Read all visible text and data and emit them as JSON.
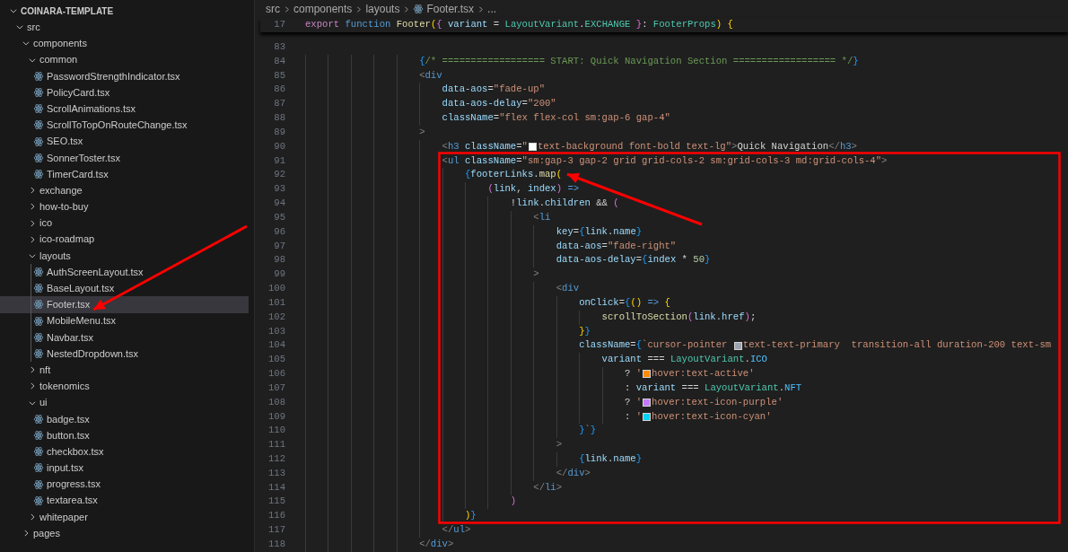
{
  "explorer": {
    "tree": [
      {
        "label": "COINARA-TEMPLATE",
        "kind": "root",
        "expanded": true,
        "selected": false,
        "children": [
          {
            "label": "src",
            "kind": "folder",
            "expanded": true,
            "selected": false,
            "children": [
              {
                "label": "components",
                "kind": "folder",
                "expanded": true,
                "selected": false,
                "children": [
                  {
                    "label": "common",
                    "kind": "folder",
                    "expanded": true,
                    "selected": false,
                    "children": [
                      {
                        "label": "PasswordStrengthIndicator.tsx",
                        "kind": "file",
                        "selected": false
                      },
                      {
                        "label": "PolicyCard.tsx",
                        "kind": "file",
                        "selected": false
                      },
                      {
                        "label": "ScrollAnimations.tsx",
                        "kind": "file",
                        "selected": false
                      },
                      {
                        "label": "ScrollToTopOnRouteChange.tsx",
                        "kind": "file",
                        "selected": false
                      },
                      {
                        "label": "SEO.tsx",
                        "kind": "file",
                        "selected": false
                      },
                      {
                        "label": "SonnerToster.tsx",
                        "kind": "file",
                        "selected": false
                      },
                      {
                        "label": "TimerCard.tsx",
                        "kind": "file",
                        "selected": false
                      }
                    ]
                  },
                  {
                    "label": "exchange",
                    "kind": "folder",
                    "expanded": false,
                    "selected": false
                  },
                  {
                    "label": "how-to-buy",
                    "kind": "folder",
                    "expanded": false,
                    "selected": false
                  },
                  {
                    "label": "ico",
                    "kind": "folder",
                    "expanded": false,
                    "selected": false
                  },
                  {
                    "label": "ico-roadmap",
                    "kind": "folder",
                    "expanded": false,
                    "selected": false
                  },
                  {
                    "label": "layouts",
                    "kind": "folder",
                    "expanded": true,
                    "selected": false,
                    "children": [
                      {
                        "label": "AuthScreenLayout.tsx",
                        "kind": "file",
                        "selected": false
                      },
                      {
                        "label": "BaseLayout.tsx",
                        "kind": "file",
                        "selected": false
                      },
                      {
                        "label": "Footer.tsx",
                        "kind": "file",
                        "selected": true
                      },
                      {
                        "label": "MobileMenu.tsx",
                        "kind": "file",
                        "selected": false
                      },
                      {
                        "label": "Navbar.tsx",
                        "kind": "file",
                        "selected": false
                      },
                      {
                        "label": "NestedDropdown.tsx",
                        "kind": "file",
                        "selected": false
                      }
                    ]
                  },
                  {
                    "label": "nft",
                    "kind": "folder",
                    "expanded": false,
                    "selected": false
                  },
                  {
                    "label": "tokenomics",
                    "kind": "folder",
                    "expanded": false,
                    "selected": false
                  },
                  {
                    "label": "ui",
                    "kind": "folder",
                    "expanded": true,
                    "selected": false,
                    "children": [
                      {
                        "label": "badge.tsx",
                        "kind": "file",
                        "selected": false
                      },
                      {
                        "label": "button.tsx",
                        "kind": "file",
                        "selected": false
                      },
                      {
                        "label": "checkbox.tsx",
                        "kind": "file",
                        "selected": false
                      },
                      {
                        "label": "input.tsx",
                        "kind": "file",
                        "selected": false
                      },
                      {
                        "label": "progress.tsx",
                        "kind": "file",
                        "selected": false
                      },
                      {
                        "label": "textarea.tsx",
                        "kind": "file",
                        "selected": false
                      }
                    ]
                  },
                  {
                    "label": "whitepaper",
                    "kind": "folder",
                    "expanded": false,
                    "selected": false
                  }
                ]
              },
              {
                "label": "pages",
                "kind": "folder",
                "expanded": false,
                "selected": false
              }
            ]
          }
        ]
      }
    ]
  },
  "breadcrumbs": [
    {
      "label": "src",
      "kind": "folder"
    },
    {
      "label": "components",
      "kind": "folder"
    },
    {
      "label": "layouts",
      "kind": "folder"
    },
    {
      "label": "Footer.tsx",
      "kind": "file"
    },
    {
      "label": "...",
      "kind": "more"
    }
  ],
  "sticky_line": {
    "number": "17",
    "tokens": [
      {
        "kind": "control",
        "text": "export"
      },
      {
        "kind": "keyword",
        "text": " function"
      },
      {
        "kind": "function",
        "text": " Footer"
      },
      {
        "kind": "brace1",
        "text": "("
      },
      {
        "kind": "brace2",
        "text": "{"
      },
      {
        "kind": "variable",
        "text": " variant"
      },
      {
        "kind": "plain",
        "text": " = "
      },
      {
        "kind": "type",
        "text": "LayoutVariant"
      },
      {
        "kind": "plain",
        "text": "."
      },
      {
        "kind": "type",
        "text": "EXCHANGE"
      },
      {
        "kind": "brace2",
        "text": " }"
      },
      {
        "kind": "plain",
        "text": ": "
      },
      {
        "kind": "type",
        "text": "FooterProps"
      },
      {
        "kind": "brace1",
        "text": ")"
      },
      {
        "kind": "brace1",
        "text": " {"
      }
    ]
  },
  "lines": [
    {
      "number": "83"
    },
    {
      "number": "84",
      "tokens": [
        {
          "kind": "brace3",
          "text": "                    {"
        },
        {
          "kind": "comment",
          "text": "/* ================== START: Quick Navigation Section ================== */"
        },
        {
          "kind": "brace3",
          "text": "}"
        }
      ]
    },
    {
      "number": "85",
      "tokens": [
        {
          "kind": "angle",
          "text": "                    <"
        },
        {
          "kind": "keyword",
          "text": "div"
        }
      ]
    },
    {
      "number": "86",
      "tokens": [
        {
          "kind": "variable",
          "text": "                        data-aos"
        },
        {
          "kind": "plain",
          "text": "="
        },
        {
          "kind": "string",
          "text": "\"fade-up\""
        }
      ]
    },
    {
      "number": "87",
      "tokens": [
        {
          "kind": "variable",
          "text": "                        data-aos-delay"
        },
        {
          "kind": "plain",
          "text": "="
        },
        {
          "kind": "string",
          "text": "\"200\""
        }
      ]
    },
    {
      "number": "88",
      "tokens": [
        {
          "kind": "variable",
          "text": "                        className"
        },
        {
          "kind": "plain",
          "text": "="
        },
        {
          "kind": "string",
          "text": "\"flex flex-col sm:gap-6 gap-4\""
        }
      ]
    },
    {
      "number": "89",
      "tokens": [
        {
          "kind": "angle",
          "text": "                    >"
        }
      ]
    },
    {
      "number": "90",
      "tokens": [
        {
          "kind": "angle",
          "text": "                        <"
        },
        {
          "kind": "keyword",
          "text": "h3"
        },
        {
          "kind": "variable",
          "text": " className"
        },
        {
          "kind": "plain",
          "text": "="
        },
        {
          "kind": "string",
          "text": "\""
        },
        {
          "kind": "swatch",
          "color": "#ffffff"
        },
        {
          "kind": "string",
          "text": "text-background font-bold text-lg\""
        },
        {
          "kind": "angle",
          "text": ">"
        },
        {
          "kind": "plain",
          "text": "Quick Navigation"
        },
        {
          "kind": "angle",
          "text": "</"
        },
        {
          "kind": "keyword",
          "text": "h3"
        },
        {
          "kind": "angle",
          "text": ">"
        }
      ]
    },
    {
      "number": "91",
      "tokens": [
        {
          "kind": "angle",
          "text": "                        <"
        },
        {
          "kind": "keyword",
          "text": "ul"
        },
        {
          "kind": "variable",
          "text": " className"
        },
        {
          "kind": "plain",
          "text": "="
        },
        {
          "kind": "string",
          "text": "\"sm:gap-3 gap-2 grid grid-cols-2 sm:grid-cols-3 md:grid-cols-4\""
        },
        {
          "kind": "angle",
          "text": ">"
        }
      ]
    },
    {
      "number": "92",
      "tokens": [
        {
          "kind": "brace3",
          "text": "                            {"
        },
        {
          "kind": "variable",
          "text": "footerLinks"
        },
        {
          "kind": "plain",
          "text": "."
        },
        {
          "kind": "function",
          "text": "map"
        },
        {
          "kind": "brace1",
          "text": "("
        }
      ]
    },
    {
      "number": "93",
      "tokens": [
        {
          "kind": "brace2",
          "text": "                                ("
        },
        {
          "kind": "variable",
          "text": "link"
        },
        {
          "kind": "plain",
          "text": ", "
        },
        {
          "kind": "variable",
          "text": "index"
        },
        {
          "kind": "brace2",
          "text": ")"
        },
        {
          "kind": "keyword",
          "text": " =>"
        }
      ]
    },
    {
      "number": "94",
      "tokens": [
        {
          "kind": "plain",
          "text": "                                    !"
        },
        {
          "kind": "variable",
          "text": "link"
        },
        {
          "kind": "plain",
          "text": "."
        },
        {
          "kind": "variable",
          "text": "children"
        },
        {
          "kind": "plain",
          "text": " && "
        },
        {
          "kind": "brace2",
          "text": "("
        }
      ]
    },
    {
      "number": "95",
      "tokens": [
        {
          "kind": "angle",
          "text": "                                        <"
        },
        {
          "kind": "keyword",
          "text": "li"
        }
      ]
    },
    {
      "number": "96",
      "tokens": [
        {
          "kind": "variable",
          "text": "                                            key"
        },
        {
          "kind": "plain",
          "text": "="
        },
        {
          "kind": "brace3",
          "text": "{"
        },
        {
          "kind": "variable",
          "text": "link"
        },
        {
          "kind": "plain",
          "text": "."
        },
        {
          "kind": "variable",
          "text": "name"
        },
        {
          "kind": "brace3",
          "text": "}"
        }
      ]
    },
    {
      "number": "97",
      "tokens": [
        {
          "kind": "variable",
          "text": "                                            data-aos"
        },
        {
          "kind": "plain",
          "text": "="
        },
        {
          "kind": "string",
          "text": "\"fade-right\""
        }
      ]
    },
    {
      "number": "98",
      "tokens": [
        {
          "kind": "variable",
          "text": "                                            data-aos-delay"
        },
        {
          "kind": "plain",
          "text": "="
        },
        {
          "kind": "brace3",
          "text": "{"
        },
        {
          "kind": "variable",
          "text": "index"
        },
        {
          "kind": "plain",
          "text": " * "
        },
        {
          "kind": "number",
          "text": "50"
        },
        {
          "kind": "brace3",
          "text": "}"
        }
      ]
    },
    {
      "number": "99",
      "tokens": [
        {
          "kind": "angle",
          "text": "                                        >"
        }
      ]
    },
    {
      "number": "100",
      "tokens": [
        {
          "kind": "angle",
          "text": "                                            <"
        },
        {
          "kind": "keyword",
          "text": "div"
        }
      ]
    },
    {
      "number": "101",
      "tokens": [
        {
          "kind": "variable",
          "text": "                                                onClick"
        },
        {
          "kind": "plain",
          "text": "="
        },
        {
          "kind": "brace3",
          "text": "{"
        },
        {
          "kind": "brace1",
          "text": "()"
        },
        {
          "kind": "keyword",
          "text": " =>"
        },
        {
          "kind": "brace1",
          "text": " {"
        }
      ]
    },
    {
      "number": "102",
      "tokens": [
        {
          "kind": "function",
          "text": "                                                    scrollToSection"
        },
        {
          "kind": "brace2",
          "text": "("
        },
        {
          "kind": "variable",
          "text": "link"
        },
        {
          "kind": "plain",
          "text": "."
        },
        {
          "kind": "variable",
          "text": "href"
        },
        {
          "kind": "brace2",
          "text": ")"
        },
        {
          "kind": "plain",
          "text": ";"
        }
      ]
    },
    {
      "number": "103",
      "tokens": [
        {
          "kind": "brace1",
          "text": "                                                }"
        },
        {
          "kind": "brace3",
          "text": "}"
        }
      ]
    },
    {
      "number": "104",
      "tokens": [
        {
          "kind": "variable",
          "text": "                                                className"
        },
        {
          "kind": "plain",
          "text": "="
        },
        {
          "kind": "brace3",
          "text": "{"
        },
        {
          "kind": "string",
          "text": "`cursor-pointer "
        },
        {
          "kind": "swatch",
          "color": "#9ca3af"
        },
        {
          "kind": "string",
          "text": "text-text-primary  transition-all duration-200 text-sm"
        }
      ]
    },
    {
      "number": "105",
      "tokens": [
        {
          "kind": "variable",
          "text": "                                                    variant"
        },
        {
          "kind": "plain",
          "text": " === "
        },
        {
          "kind": "type",
          "text": "LayoutVariant"
        },
        {
          "kind": "plain",
          "text": "."
        },
        {
          "kind": "constant",
          "text": "ICO"
        }
      ]
    },
    {
      "number": "106",
      "tokens": [
        {
          "kind": "plain",
          "text": "                                                        ? "
        },
        {
          "kind": "string",
          "text": "'"
        },
        {
          "kind": "swatch",
          "color": "#ff8c00"
        },
        {
          "kind": "string",
          "text": "hover:text-active'"
        }
      ]
    },
    {
      "number": "107",
      "tokens": [
        {
          "kind": "plain",
          "text": "                                                        : "
        },
        {
          "kind": "variable",
          "text": "variant"
        },
        {
          "kind": "plain",
          "text": " === "
        },
        {
          "kind": "type",
          "text": "LayoutVariant"
        },
        {
          "kind": "plain",
          "text": "."
        },
        {
          "kind": "constant",
          "text": "NFT"
        }
      ]
    },
    {
      "number": "108",
      "tokens": [
        {
          "kind": "plain",
          "text": "                                                        ? "
        },
        {
          "kind": "string",
          "text": "'"
        },
        {
          "kind": "swatch",
          "color": "#c27aff"
        },
        {
          "kind": "string",
          "text": "hover:text-icon-purple'"
        }
      ]
    },
    {
      "number": "109",
      "tokens": [
        {
          "kind": "plain",
          "text": "                                                        : "
        },
        {
          "kind": "string",
          "text": "'"
        },
        {
          "kind": "swatch",
          "color": "#00d3f3"
        },
        {
          "kind": "string",
          "text": "hover:text-icon-cyan'"
        }
      ]
    },
    {
      "number": "110",
      "tokens": [
        {
          "kind": "brace3",
          "text": "                                                }"
        },
        {
          "kind": "string",
          "text": "`"
        },
        {
          "kind": "brace3",
          "text": "}"
        }
      ]
    },
    {
      "number": "111",
      "tokens": [
        {
          "kind": "angle",
          "text": "                                            >"
        }
      ]
    },
    {
      "number": "112",
      "tokens": [
        {
          "kind": "brace3",
          "text": "                                                {"
        },
        {
          "kind": "variable",
          "text": "link"
        },
        {
          "kind": "plain",
          "text": "."
        },
        {
          "kind": "variable",
          "text": "name"
        },
        {
          "kind": "brace3",
          "text": "}"
        }
      ]
    },
    {
      "number": "113",
      "tokens": [
        {
          "kind": "angle",
          "text": "                                            </"
        },
        {
          "kind": "keyword",
          "text": "div"
        },
        {
          "kind": "angle",
          "text": ">"
        }
      ]
    },
    {
      "number": "114",
      "tokens": [
        {
          "kind": "angle",
          "text": "                                        </"
        },
        {
          "kind": "keyword",
          "text": "li"
        },
        {
          "kind": "angle",
          "text": ">"
        }
      ]
    },
    {
      "number": "115",
      "tokens": [
        {
          "kind": "brace2",
          "text": "                                    )"
        }
      ]
    },
    {
      "number": "116",
      "tokens": [
        {
          "kind": "brace1",
          "text": "                            )"
        },
        {
          "kind": "brace3",
          "text": "}"
        }
      ]
    },
    {
      "number": "117",
      "tokens": [
        {
          "kind": "angle",
          "text": "                        </"
        },
        {
          "kind": "keyword",
          "text": "ul"
        },
        {
          "kind": "angle",
          "text": ">"
        }
      ]
    },
    {
      "number": "118",
      "tokens": [
        {
          "kind": "angle",
          "text": "                    </"
        },
        {
          "kind": "keyword",
          "text": "div"
        },
        {
          "kind": "angle",
          "text": ">"
        }
      ]
    }
  ],
  "annotations": [
    {
      "kind": "arrow"
    },
    {
      "kind": "arrow"
    },
    {
      "kind": "box"
    }
  ]
}
